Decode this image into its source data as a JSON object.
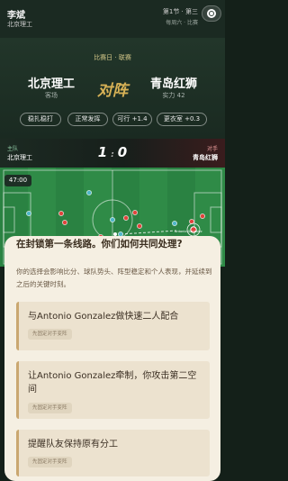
{
  "header": {
    "player_name": "李斌",
    "player_school": "北京理工",
    "round_info": "第1节 · 第三",
    "round_sub": "每周六 ·  比赛"
  },
  "match": {
    "tag": "比赛日 · 联赛",
    "team_left": {
      "name": "北京理工",
      "sub": "客场"
    },
    "versus": "对阵",
    "team_right": {
      "name": "青岛红狮",
      "sub": "实力 42"
    },
    "chips": [
      "稳扎稳打",
      "正常发挥",
      "可行 +1.4",
      "更衣室 +0.3"
    ]
  },
  "scorebar": {
    "home_tag": "主队",
    "home_name": "北京理工",
    "score_home": "1",
    "score_away": "0",
    "away_tag": "对手",
    "away_name": "青岛红狮"
  },
  "pitch": {
    "clock": "47:00",
    "marker_label": "Antonio Gonzalez",
    "ball_label": "Zandi Nkosi"
  },
  "card": {
    "question": "在封锁第一条线路。你们如何共同处理?",
    "description": "你的选择会影响比分、球队势头、阵型稳定和个人表现，并延续到之后的关键时刻。",
    "options": [
      {
        "text": "与Antonio Gonzalez做快速二人配合",
        "badge": "先固定对手变阵"
      },
      {
        "text": "让Antonio Gonzalez牵制，你攻击第二空间",
        "badge": "先固定对手变阵"
      },
      {
        "text": "提醒队友保持原有分工",
        "badge": "先固定对手变阵"
      }
    ]
  },
  "colors": {
    "home_player": "#4fb6c8",
    "away_player": "#e0443c",
    "accent_gold": "#d7b256",
    "card_bg": "#f5efe2"
  }
}
